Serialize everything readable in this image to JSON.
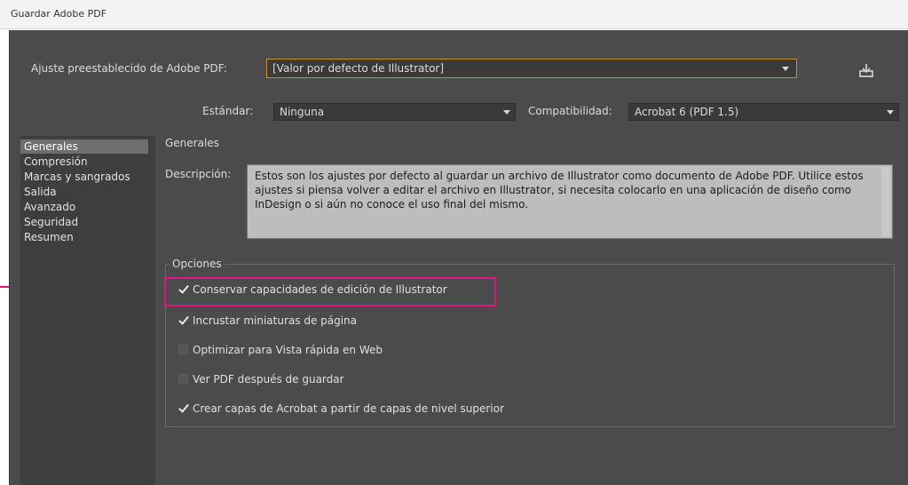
{
  "window": {
    "title": "Guardar Adobe PDF"
  },
  "preset": {
    "label": "Ajuste preestablecido de Adobe PDF:",
    "value": "[Valor por defecto de Illustrator]"
  },
  "standard": {
    "label": "Estándar:",
    "value": "Ninguna"
  },
  "compatibility": {
    "label": "Compatibilidad:",
    "value": "Acrobat 6 (PDF 1.5)"
  },
  "sidebar": {
    "items": [
      {
        "label": "Generales",
        "selected": true
      },
      {
        "label": "Compresión",
        "selected": false
      },
      {
        "label": "Marcas y sangrados",
        "selected": false
      },
      {
        "label": "Salida",
        "selected": false
      },
      {
        "label": "Avanzado",
        "selected": false
      },
      {
        "label": "Seguridad",
        "selected": false
      },
      {
        "label": "Resumen",
        "selected": false
      }
    ]
  },
  "general": {
    "section_title": "Generales",
    "description_label": "Descripción:",
    "description": "Estos son los ajustes por defecto al guardar un archivo de Illustrator como documento de Adobe PDF. Utilice estos ajustes si piensa volver a editar el archivo en Illustrator, si necesita colocarlo en una aplicación de diseño como InDesign o si aún no conoce el uso final del mismo."
  },
  "options": {
    "title": "Opciones",
    "items": [
      {
        "label": "Conservar capacidades de edición de Illustrator",
        "checked": true
      },
      {
        "label": "Incrustar miniaturas de página",
        "checked": true
      },
      {
        "label": "Optimizar para Vista rápida en Web",
        "checked": false
      },
      {
        "label": "Ver PDF después de guardar",
        "checked": false
      },
      {
        "label": "Crear capas de Acrobat a partir de capas de nivel superior",
        "checked": true
      }
    ]
  },
  "colors": {
    "dialog_bg": "#4b4b4b",
    "preset_border": "#d28a2e",
    "highlight": "#e0157f"
  },
  "icons": {
    "save_preset": "save-preset-icon"
  }
}
